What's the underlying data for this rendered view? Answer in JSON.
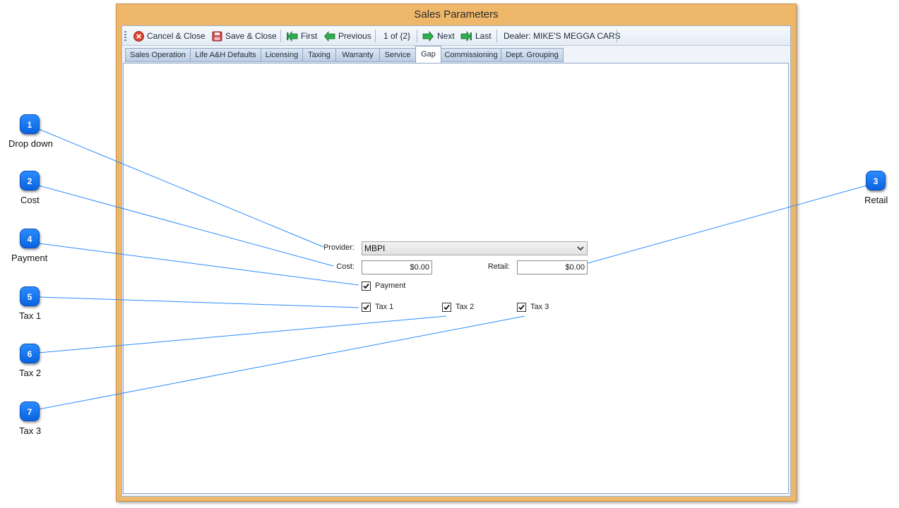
{
  "window": {
    "title": "Sales Parameters"
  },
  "toolbar": {
    "cancel_close": "Cancel & Close",
    "save_close": "Save & Close",
    "first": "First",
    "previous": "Previous",
    "record_position": "1 of {2}",
    "next": "Next",
    "last": "Last",
    "dealer": "Dealer: MIKE'S MEGGA CARS"
  },
  "tabs": [
    {
      "label": "Sales Operation"
    },
    {
      "label": "Life A&H Defaults"
    },
    {
      "label": "Licensing"
    },
    {
      "label": "Taxing"
    },
    {
      "label": "Warranty"
    },
    {
      "label": "Service"
    },
    {
      "label": "Gap",
      "active": true
    },
    {
      "label": "Commissioning"
    },
    {
      "label": "Dept. Grouping"
    }
  ],
  "form": {
    "provider_label": "Provider:",
    "provider_value": "MBPI",
    "cost_label": "Cost:",
    "cost_value": "$0.00",
    "retail_label": "Retail:",
    "retail_value": "$0.00",
    "payment_label": "Payment",
    "payment_checked": true,
    "tax1_label": "Tax 1",
    "tax1_checked": true,
    "tax2_label": "Tax 2",
    "tax2_checked": true,
    "tax3_label": "Tax 3",
    "tax3_checked": true
  },
  "callouts": [
    {
      "number": "1",
      "label": "Drop down"
    },
    {
      "number": "2",
      "label": "Cost"
    },
    {
      "number": "3",
      "label": "Retail"
    },
    {
      "number": "4",
      "label": "Payment"
    },
    {
      "number": "5",
      "label": "Tax 1"
    },
    {
      "number": "6",
      "label": "Tax 2"
    },
    {
      "number": "7",
      "label": "Tax 3"
    }
  ],
  "colors": {
    "window_frame": "#efb76a",
    "callout_blue": "#0a63e0",
    "callout_line": "#2b8cff"
  }
}
